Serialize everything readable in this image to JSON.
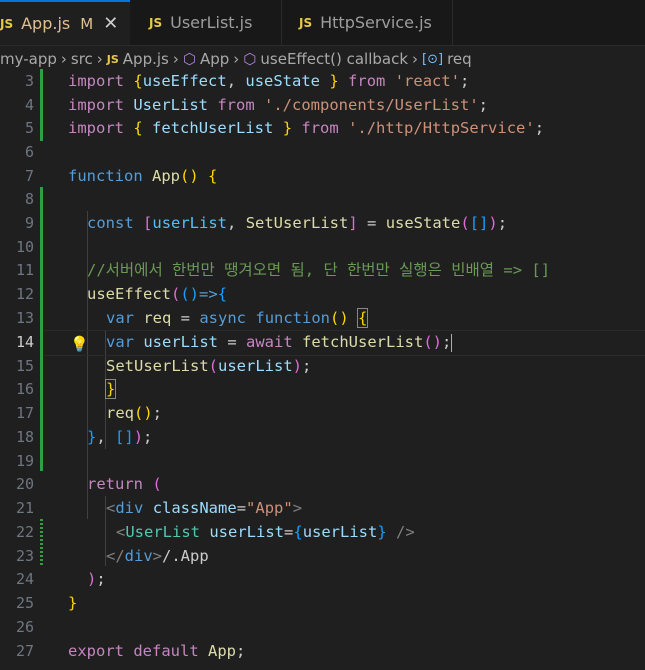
{
  "tabs": [
    {
      "icon": "JS",
      "name": "App.js",
      "modified": "M",
      "close": "✕",
      "active": true
    },
    {
      "icon": "JS",
      "name": "UserList.js",
      "active": false
    },
    {
      "icon": "JS",
      "name": "HttpService.js",
      "active": false
    }
  ],
  "breadcrumb": {
    "items": [
      "my-app",
      "src",
      "App.js",
      "App",
      "useEffect() callback",
      "req"
    ]
  },
  "lines": [
    {
      "n": "3"
    },
    {
      "n": "4"
    },
    {
      "n": "5"
    },
    {
      "n": "6"
    },
    {
      "n": "7"
    },
    {
      "n": "8"
    },
    {
      "n": "9"
    },
    {
      "n": "10"
    },
    {
      "n": "11"
    },
    {
      "n": "12"
    },
    {
      "n": "13"
    },
    {
      "n": "14"
    },
    {
      "n": "15"
    },
    {
      "n": "16"
    },
    {
      "n": "17"
    },
    {
      "n": "18"
    },
    {
      "n": "19"
    },
    {
      "n": "20"
    },
    {
      "n": "21"
    },
    {
      "n": "22"
    },
    {
      "n": "23"
    },
    {
      "n": "24"
    },
    {
      "n": "25"
    },
    {
      "n": "26"
    },
    {
      "n": "27"
    }
  ],
  "tokens": {
    "import": "import",
    "useEffect": "useEffect",
    "useState": "useState",
    "from": "from",
    "react": "'react'",
    "UserList": "UserList",
    "userListPath": "'./components/UserList'",
    "fetchUserList": "fetchUserList",
    "httpPath": "'./http/HttpService'",
    "function": "function",
    "App": "App",
    "const": "const",
    "userList": "userList",
    "SetUserList": "SetUserList",
    "comment": "//서버에서 한번만 땡겨오면 됨, 단 한번만 실행은 빈배열 => []",
    "var": "var",
    "req": "req",
    "async": "async",
    "await": "await",
    "return": "return",
    "div": "div",
    "className": "className",
    "appStr": "\"App\"",
    "divComment": "/.App",
    "export": "export",
    "default": "default"
  },
  "colors": {
    "background": "#1f1f1f",
    "keyword": "#569cd6",
    "control": "#c586c0",
    "function": "#dcdcaa",
    "variable": "#9cdcfe",
    "string": "#ce9178",
    "comment": "#6a9955",
    "gitAdded": "#2ea043"
  },
  "icons": {
    "lightbulb": "lightbulb-icon",
    "js": "js-file-icon",
    "cube": "symbol-method-icon",
    "variable": "symbol-variable-icon"
  }
}
